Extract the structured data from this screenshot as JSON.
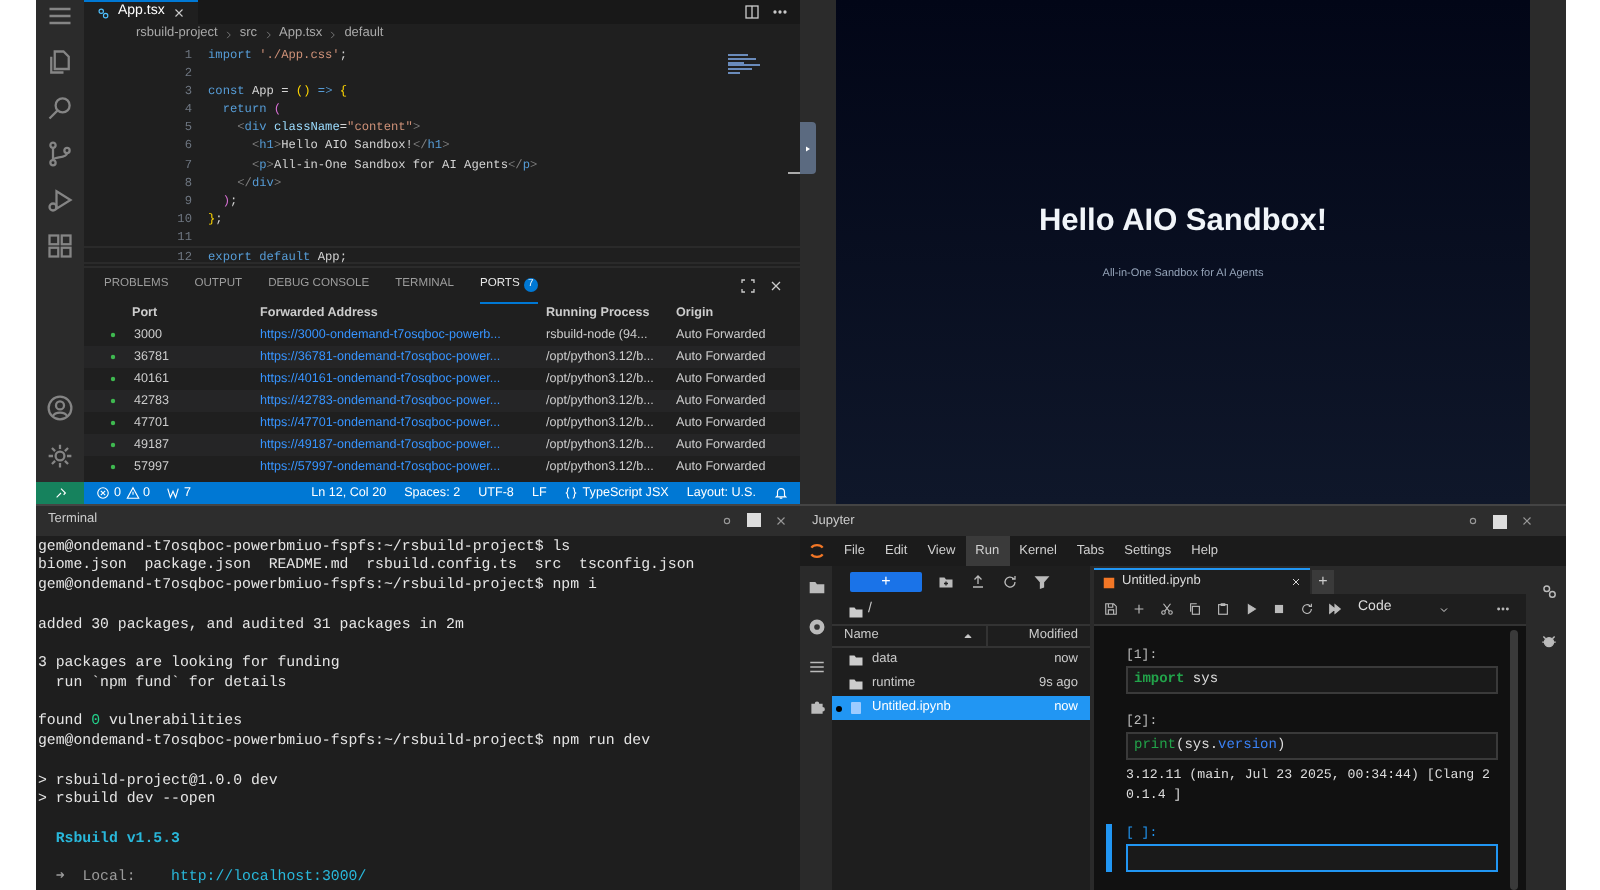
{
  "editor": {
    "tab": {
      "label": "App.tsx",
      "selected": true
    },
    "breadcrumb": [
      "rsbuild-project",
      "src",
      "App.tsx",
      "default"
    ],
    "lines": [
      {
        "number": "1",
        "tokens": [
          {
            "text": "import ",
            "kind": "control"
          },
          {
            "text": "'./App.css'",
            "kind": "string"
          },
          {
            "text": ";",
            "kind": "plain"
          }
        ]
      },
      {
        "number": "2"
      },
      {
        "number": "3",
        "tokens": [
          {
            "text": "const ",
            "kind": "keyword"
          },
          {
            "text": "App",
            "kind": "plain"
          },
          {
            "text": " = ",
            "kind": "plain"
          },
          {
            "text": "()",
            "kind": "brace"
          },
          {
            "text": " => ",
            "kind": "keyword"
          },
          {
            "text": "{",
            "kind": "brace"
          }
        ]
      },
      {
        "number": "4",
        "tokens": [
          {
            "text": "  return ",
            "kind": "control"
          },
          {
            "text": "(",
            "kind": "paren"
          }
        ]
      },
      {
        "number": "5",
        "tokens": [
          {
            "text": "    <",
            "kind": "bracket"
          },
          {
            "text": "div",
            "kind": "keyword"
          },
          {
            "text": " className",
            "kind": "attr"
          },
          {
            "text": "=",
            "kind": "plain"
          },
          {
            "text": "\"content\"",
            "kind": "string"
          },
          {
            "text": ">",
            "kind": "bracket"
          }
        ]
      },
      {
        "number": "6",
        "tokens": [
          {
            "text": "      <",
            "kind": "bracket"
          },
          {
            "text": "h1",
            "kind": "keyword"
          },
          {
            "text": ">",
            "kind": "bracket"
          },
          {
            "text": "Hello AIO Sandbox!",
            "kind": "plain"
          },
          {
            "text": "</",
            "kind": "bracket"
          },
          {
            "text": "h1",
            "kind": "keyword"
          },
          {
            "text": ">",
            "kind": "bracket"
          }
        ]
      },
      {
        "number": "7",
        "tokens": [
          {
            "text": "      <",
            "kind": "bracket"
          },
          {
            "text": "p",
            "kind": "keyword"
          },
          {
            "text": ">",
            "kind": "bracket"
          },
          {
            "text": "All-in-One Sandbox for AI Agents",
            "kind": "plain"
          },
          {
            "text": "</",
            "kind": "bracket"
          },
          {
            "text": "p",
            "kind": "keyword"
          },
          {
            "text": ">",
            "kind": "bracket"
          }
        ]
      },
      {
        "number": "8",
        "tokens": [
          {
            "text": "    </",
            "kind": "bracket"
          },
          {
            "text": "div",
            "kind": "keyword"
          },
          {
            "text": ">",
            "kind": "bracket"
          }
        ]
      },
      {
        "number": "9",
        "tokens": [
          {
            "text": "  )",
            "kind": "paren"
          },
          {
            "text": ";",
            "kind": "plain"
          }
        ]
      },
      {
        "number": "10",
        "tokens": [
          {
            "text": "}",
            "kind": "brace"
          },
          {
            "text": ";",
            "kind": "plain"
          }
        ]
      },
      {
        "number": "11"
      },
      {
        "number": "12",
        "tokens": [
          {
            "text": "export default ",
            "kind": "control"
          },
          {
            "text": "App",
            "kind": "plain"
          },
          {
            "text": ";",
            "kind": "plain"
          }
        ]
      }
    ],
    "panel": {
      "tabs": [
        {
          "label": "PROBLEMS",
          "selected": false
        },
        {
          "label": "OUTPUT",
          "selected": false
        },
        {
          "label": "DEBUG CONSOLE",
          "selected": false
        },
        {
          "label": "TERMINAL",
          "selected": false
        },
        {
          "label": "PORTS",
          "selected": true,
          "badge": "7"
        }
      ],
      "columns": [
        "Port",
        "Forwarded Address",
        "Running Process",
        "Origin"
      ],
      "rows": [
        {
          "port": "3000",
          "address": "https://3000-ondemand-t7osqboc-powerb...",
          "process": "rsbuild-node (94...",
          "origin": "Auto Forwarded"
        },
        {
          "port": "36781",
          "address": "https://36781-ondemand-t7osqboc-power...",
          "process": "/opt/python3.12/b...",
          "origin": "Auto Forwarded"
        },
        {
          "port": "40161",
          "address": "https://40161-ondemand-t7osqboc-power...",
          "process": "/opt/python3.12/b...",
          "origin": "Auto Forwarded"
        },
        {
          "port": "42783",
          "address": "https://42783-ondemand-t7osqboc-power...",
          "process": "/opt/python3.12/b...",
          "origin": "Auto Forwarded"
        },
        {
          "port": "47701",
          "address": "https://47701-ondemand-t7osqboc-power...",
          "process": "/opt/python3.12/b...",
          "origin": "Auto Forwarded"
        },
        {
          "port": "49187",
          "address": "https://49187-ondemand-t7osqboc-power...",
          "process": "/opt/python3.12/b...",
          "origin": "Auto Forwarded"
        },
        {
          "port": "57997",
          "address": "https://57997-ondemand-t7osqboc-power...",
          "process": "/opt/python3.12/b...",
          "origin": "Auto Forwarded"
        }
      ]
    },
    "status_bar": {
      "errors": "0",
      "warnings": "0",
      "ports": "7",
      "items": [
        "Ln 12, Col 20",
        "Spaces: 2",
        "UTF-8",
        "LF",
        "TypeScript JSX",
        "Layout: U.S."
      ]
    }
  },
  "terminal": {
    "title": "Terminal",
    "lines": [
      {
        "segments": [
          {
            "text": "gem@ondemand-t7osqboc-powerbmiuo-fspfs:~/rsbuild-project$ ls",
            "kind": "plain"
          }
        ]
      },
      {
        "segments": [
          {
            "text": "biome.json  package.json  README.md  rsbuild.config.ts  src  tsconfig.json",
            "kind": "plain"
          }
        ]
      },
      {
        "segments": [
          {
            "text": "gem@ondemand-t7osqboc-powerbmiuo-fspfs:~/rsbuild-project$ npm i",
            "kind": "plain"
          }
        ]
      },
      {
        "blank_before": true,
        "segments": [
          {
            "text": "added 30 packages, and audited 31 packages in 2m",
            "kind": "plain"
          }
        ]
      },
      {
        "blank_before": true,
        "segments": [
          {
            "text": "3 packages are looking for funding",
            "kind": "plain"
          }
        ]
      },
      {
        "segments": [
          {
            "text": "  run `npm fund` for details",
            "kind": "plain"
          }
        ]
      },
      {
        "blank_before": true,
        "segments": [
          {
            "text": "found ",
            "kind": "plain"
          },
          {
            "text": "0",
            "kind": "good"
          },
          {
            "text": " vulnerabilities",
            "kind": "plain"
          }
        ]
      },
      {
        "segments": [
          {
            "text": "gem@ondemand-t7osqboc-powerbmiuo-fspfs:~/rsbuild-project$ npm run dev",
            "kind": "plain"
          }
        ]
      },
      {
        "blank_before": true,
        "segments": [
          {
            "text": "> rsbuild-project@1.0.0 dev",
            "kind": "plain"
          }
        ]
      },
      {
        "segments": [
          {
            "text": "> rsbuild dev --open",
            "kind": "plain"
          }
        ]
      },
      {
        "blank_before": true,
        "segments": [
          {
            "text": "  Rsbuild v1.5.3",
            "kind": "brand"
          }
        ]
      },
      {
        "blank_before": true,
        "segments": [
          {
            "text": "  ➜  Local:",
            "kind": "dim"
          },
          {
            "text": "    http://localhost:3000/",
            "kind": "link"
          }
        ]
      }
    ]
  },
  "preview": {
    "heading": "Hello AIO Sandbox!",
    "subtitle": "All-in-One Sandbox for AI Agents"
  },
  "jupyter": {
    "title": "Jupyter",
    "menu": [
      {
        "label": "File",
        "selected": false
      },
      {
        "label": "Edit",
        "selected": false
      },
      {
        "label": "View",
        "selected": false
      },
      {
        "label": "Run",
        "selected": true
      },
      {
        "label": "Kernel",
        "selected": false
      },
      {
        "label": "Tabs",
        "selected": false
      },
      {
        "label": "Settings",
        "selected": false
      },
      {
        "label": "Help",
        "selected": false
      }
    ],
    "file_browser": {
      "new_button": "+",
      "path": "/",
      "columns": [
        "Name",
        "Modified"
      ],
      "items": [
        {
          "name": "data",
          "modified": "now",
          "kind": "folder",
          "selected": false
        },
        {
          "name": "runtime",
          "modified": "9s ago",
          "kind": "folder",
          "selected": false
        },
        {
          "name": "Untitled.ipynb",
          "modified": "now",
          "kind": "notebook",
          "selected": true
        }
      ]
    },
    "notebook": {
      "tab": "Untitled.ipynb",
      "add_tab": "+",
      "cell_type": "Code",
      "cells": [
        {
          "prompt": "[1]:",
          "active": false,
          "tokens": [
            {
              "text": "import",
              "kind": "keyword"
            },
            {
              "text": " sys",
              "kind": "plain"
            }
          ]
        },
        {
          "prompt": "[2]:",
          "active": false,
          "tokens": [
            {
              "text": "print",
              "kind": "builtin"
            },
            {
              "text": "(sys.",
              "kind": "plain"
            },
            {
              "text": "version",
              "kind": "attr"
            },
            {
              "text": ")",
              "kind": "plain"
            }
          ],
          "output": "3.12.11 (main, Jul 23 2025, 00:34:44) [Clang 20.1.4 ]"
        },
        {
          "prompt": "[ ]:",
          "active": true
        }
      ]
    }
  }
}
